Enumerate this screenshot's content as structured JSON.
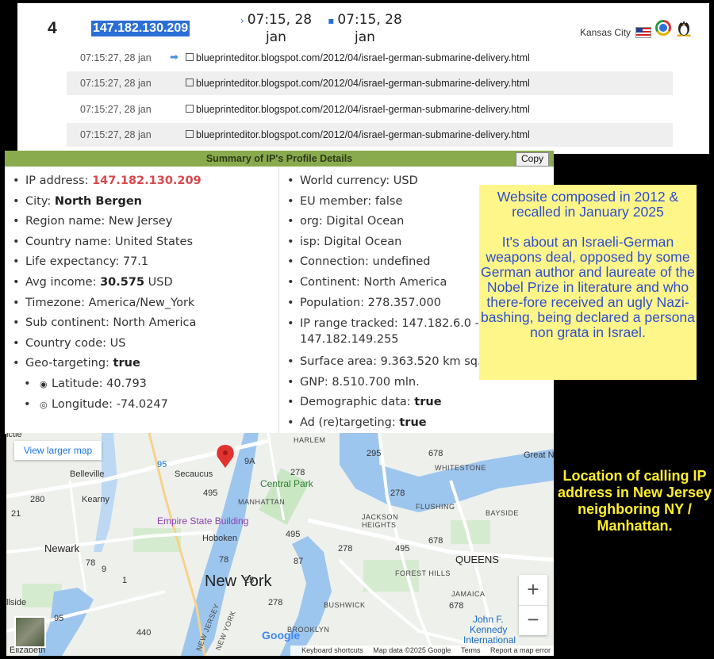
{
  "visit": {
    "number": "4",
    "ip": "147.182.130.209",
    "first_time": "07:15, 28",
    "first_date": "jan",
    "last_time": "07:15, 28",
    "last_date": "jan",
    "city": "Kansas City"
  },
  "log": [
    {
      "time": "07:15:27, 28 jan",
      "url": "blueprinteditor.blogspot.com/2012/04/israel-german-submarine-delivery.html",
      "entry": true
    },
    {
      "time": "07:15:27, 28 jan",
      "url": "blueprinteditor.blogspot.com/2012/04/israel-german-submarine-delivery.html"
    },
    {
      "time": "07:15:27, 28 jan",
      "url": "blueprinteditor.blogspot.com/2012/04/israel-german-submarine-delivery.html"
    },
    {
      "time": "07:15:27, 28 jan",
      "url": "blueprinteditor.blogspot.com/2012/04/israel-german-submarine-delivery.html"
    }
  ],
  "summary": {
    "title": "Summary of IP's Profile Details",
    "copy_label": "Copy",
    "left": {
      "ip_label": "IP address: ",
      "ip_value": "147.182.130.209",
      "city_label": "City: ",
      "city_value": "North Bergen",
      "region": "Region name: New Jersey",
      "country": "Country name: United States",
      "life": "Life expectancy: 77.1",
      "income_label": "Avg income: ",
      "income_value": "30.575",
      "income_unit": " USD",
      "timezone": "Timezone: America/New_York",
      "subcontinent": "Sub continent: North America",
      "country_code": "Country code: US",
      "geo_label": "Geo-targeting: ",
      "geo_value": "true",
      "latitude": "Latitude: 40.793",
      "longitude": "Longitude: -74.0247"
    },
    "right": {
      "currency": "World currency: USD",
      "eu": "EU member: false",
      "org": "org: Digital Ocean",
      "isp": "isp: Digital Ocean",
      "connection": "Connection: undefined",
      "continent": "Continent: North America",
      "population": "Population: 278.357.000",
      "ip_range_a": "IP range tracked: 147.182.6.0 -",
      "ip_range_b": "147.182.149.255",
      "surface": "Surface area: 9.363.520 km sq.",
      "gnp": "GNP: 8.510.700 mln.",
      "demo_label": "Demographic data: ",
      "demo_value": "true",
      "ad_label": "Ad (re)targeting: ",
      "ad_value": "true"
    }
  },
  "note1": {
    "p1": "Website composed in 2012 & recalled in January 2025",
    "p2": "It's about an Israeli-German weapons deal, opposed by some German author and laureate of the Nobel Prize in literature and who there-fore received an ugly Nazi-bashing, being declared a persona non grata in Israel."
  },
  "note2": "Location of calling IP address in New Jersey neighboring NY / Manhattan.",
  "map": {
    "larger": "View larger map",
    "labels": {
      "secaucus": "Secaucus",
      "belleville": "Belleville",
      "kearny": "Kearny",
      "newark": "Newark",
      "hoboken": "Hoboken",
      "new_york": "New York",
      "manhattan": "MANHATTAN",
      "central_park": "Central Park",
      "empire": "Empire State Building",
      "harlem": "HARLEM",
      "whitestone": "WHITESTONE",
      "flushing": "FLUSHING",
      "bayside": "BAYSIDE",
      "queens": "QUEENS",
      "jackson": "JACKSON",
      "heights": "HEIGHTS",
      "forest_hills": "FOREST HILLS",
      "jamaica": "JAMAICA",
      "bushwick": "BUSHWICK",
      "brooklyn": "BROOKLYN",
      "new_jersey": "NEW JERSEY",
      "new_york_st": "NEW YORK",
      "great_n": "Great N",
      "jfk1": "John F.",
      "jfk2": "Kennedy",
      "jfk3": "International",
      "elizabeth": "Elizabeth",
      "llside": "llside",
      "ictle": "ictle",
      "google": "Google",
      "r95a": "95",
      "r495": "495",
      "r278a": "278",
      "r278b": "278",
      "r278c": "278",
      "r678a": "678",
      "r678b": "678",
      "r678c": "678",
      "r495b": "495",
      "r495c": "495",
      "r78a": "78",
      "r78b": "78",
      "r95b": "95",
      "r440": "440",
      "r9": "9",
      "r278d": "278",
      "r1": "1",
      "r21": "21",
      "r280": "280",
      "r295": "295",
      "r25": "25",
      "r87": "87",
      "r9a": "9A"
    },
    "zoom_in": "+",
    "zoom_out": "−",
    "attrib_shortcuts": "Keyboard shortcuts",
    "attrib_data": "Map data ©2025 Google",
    "attrib_terms": "Terms",
    "attrib_report": "Report a map error"
  }
}
